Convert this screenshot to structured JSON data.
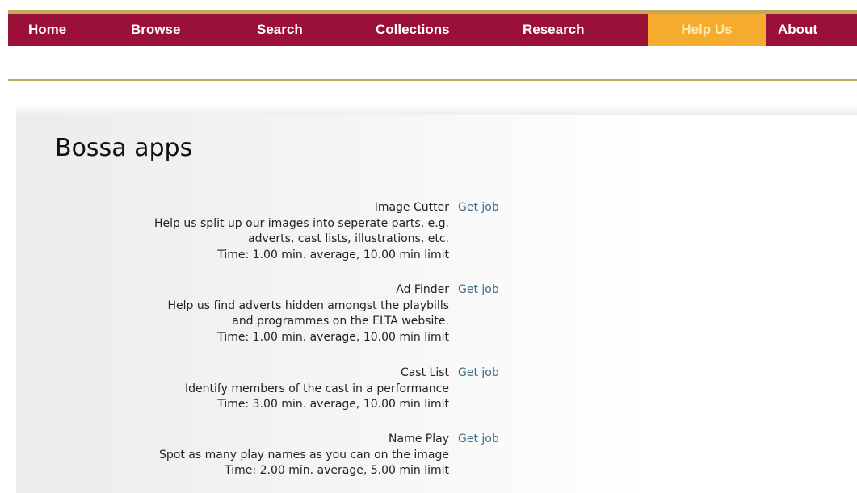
{
  "nav": {
    "items": [
      {
        "label": "Home"
      },
      {
        "label": "Browse"
      },
      {
        "label": "Search"
      },
      {
        "label": "Collections"
      },
      {
        "label": "Research"
      },
      {
        "label": "Help Us"
      },
      {
        "label": "About"
      }
    ],
    "active_index": 5
  },
  "page": {
    "title": "Bossa apps"
  },
  "apps": [
    {
      "name": "Image Cutter",
      "description_lines": [
        "Help us split up our images into seperate parts, e.g.",
        "adverts, cast lists, illustrations, etc."
      ],
      "time": "Time: 1.00 min. average, 10.00 min limit",
      "action_label": "Get job"
    },
    {
      "name": "Ad Finder",
      "description_lines": [
        "Help us find adverts hidden amongst the playbills",
        "and programmes on the ELTA website."
      ],
      "time": "Time: 1.00 min. average, 10.00 min limit",
      "action_label": "Get job"
    },
    {
      "name": "Cast List",
      "description_lines": [
        "Identify members of the cast in a performance"
      ],
      "time": "Time: 3.00 min. average, 10.00 min limit",
      "action_label": "Get job"
    },
    {
      "name": "Name Play",
      "description_lines": [
        "Spot as many play names as you can on the image"
      ],
      "time": "Time: 2.00 min. average, 5.00 min limit",
      "action_label": "Get job"
    }
  ],
  "colors": {
    "nav_background": "#9a1038",
    "nav_active": "#f5ab2e",
    "rule": "#b8ae5c",
    "link": "#3f6e84"
  }
}
